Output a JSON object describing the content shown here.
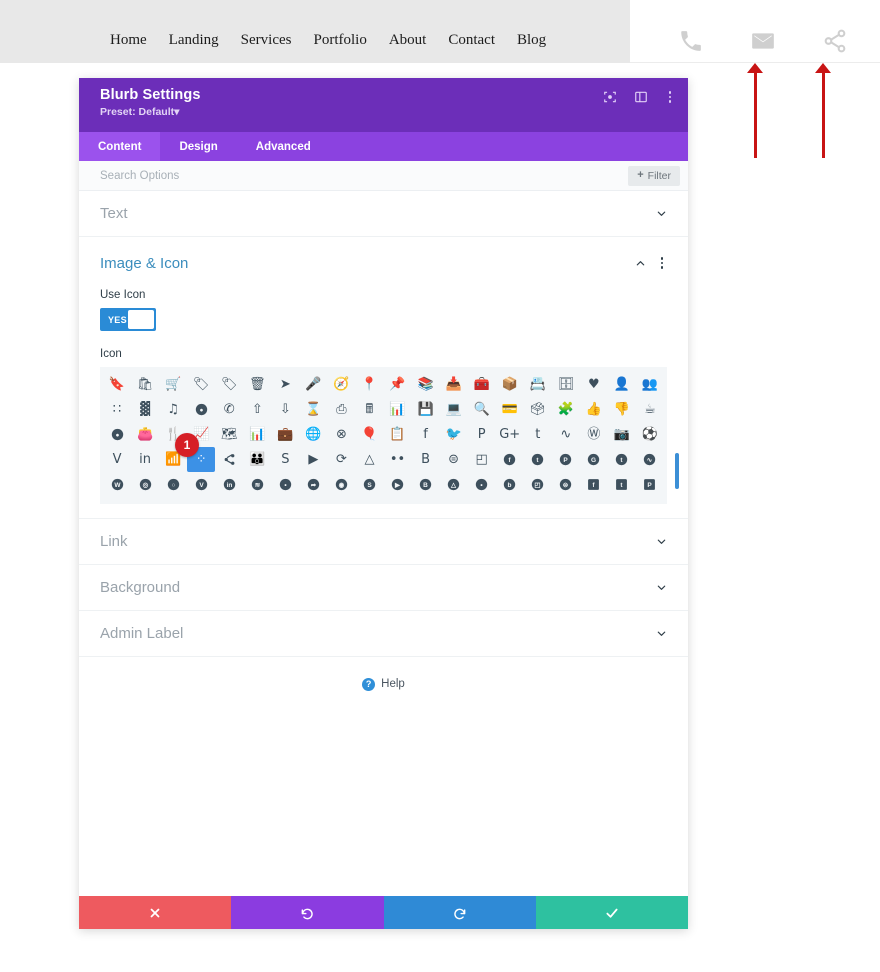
{
  "site_header": {
    "nav": [
      {
        "label": "Home"
      },
      {
        "label": "Landing"
      },
      {
        "label": "Services"
      },
      {
        "label": "Portfolio"
      },
      {
        "label": "About"
      },
      {
        "label": "Contact"
      },
      {
        "label": "Blog"
      }
    ],
    "icons": [
      {
        "name": "phone-icon"
      },
      {
        "name": "mail-icon"
      },
      {
        "name": "share-icon"
      }
    ],
    "background": "#e8e8e8"
  },
  "annotations": {
    "arrow_color": "#c81414",
    "arrows": [
      {
        "target": "mail-icon"
      },
      {
        "target": "share-icon"
      }
    ]
  },
  "modal": {
    "title": "Blurb Settings",
    "preset": "Preset: Default",
    "preset_caret": "▾",
    "header_color": "#6c2eb9",
    "header_icons": [
      {
        "name": "focus-target-icon"
      },
      {
        "name": "layout-panel-icon"
      },
      {
        "name": "kebab-menu-icon"
      }
    ],
    "tabs": [
      {
        "label": "Content",
        "active": true
      },
      {
        "label": "Design",
        "active": false
      },
      {
        "label": "Advanced",
        "active": false
      }
    ],
    "search": {
      "placeholder": "Search Options",
      "value": "",
      "filter_label": "Filter",
      "filter_plus": "+"
    },
    "sections": [
      {
        "label": "Text",
        "open": false
      },
      {
        "label": "Image & Icon",
        "open": true
      },
      {
        "label": "Link",
        "open": false
      },
      {
        "label": "Background",
        "open": false
      },
      {
        "label": "Admin Label",
        "open": false
      }
    ],
    "image_icon_section": {
      "use_icon_label": "Use Icon",
      "use_icon_value": "YES",
      "icon_field_label": "Icon",
      "selected_icon_index": 63,
      "selected_badge": "1",
      "selected_icon_name": "share-nodes-icon",
      "selected_color": "#3c91e6",
      "grid_columns": 20,
      "icons": [
        "bookmark-icon",
        "briefcase-bag-icon",
        "shopping-cart-icon",
        "tag-icon",
        "tag-filled-icon",
        "trash-icon",
        "cursor-arrow-icon",
        "microphone-icon",
        "compass-icon",
        "map-pin-icon",
        "pushpin-icon",
        "books-icon",
        "inbox-tray-icon",
        "toolbox-icon",
        "box-archive-icon",
        "id-card-icon",
        "archive-box-icon",
        "heart-icon",
        "user-icon",
        "users-icon",
        "grid-four-icon",
        "grid-nine-icon",
        "music-note-icon",
        "pause-circle-icon",
        "phone-icon",
        "upload-icon",
        "download-icon",
        "hourglass-icon",
        "printer-icon",
        "calculator-icon",
        "bar-chart-icon",
        "floppy-disk-icon",
        "laptop-icon",
        "document-search-icon",
        "card-icon",
        "toolbox-open-icon",
        "puzzle-piece-icon",
        "thumbs-up-icon",
        "thumbs-down-icon",
        "mug-icon",
        "dollar-circle-icon",
        "wallet-icon",
        "cutlery-icon",
        "presentation-chart-icon",
        "sitemap-icon",
        "chart-column-icon",
        "suitcase-icon",
        "globe-split-icon",
        "globe-cross-icon",
        "balloon-icon",
        "clipboard-icon",
        "facebook-f-icon",
        "twitter-bird-icon",
        "pinterest-p-icon",
        "google-plus-icon",
        "tumblr-t-icon",
        "soundwave-icon",
        "wordpress-icon",
        "instagram-icon",
        "dribbble-icon",
        "vimeo-v-icon",
        "linkedin-in-icon",
        "rss-icon",
        "flickr-icon",
        "share-nodes-icon",
        "meetup-icon",
        "skype-icon",
        "youtube-icon",
        "tripadvisor-icon",
        "google-drive-icon",
        "flickr-dots-icon",
        "blogger-b-icon",
        "spotify-icon",
        "delicious-icon",
        "facebook-circle-icon",
        "twitter-circle-icon",
        "pinterest-circle-icon",
        "google-circle-icon",
        "tumblr-circle-icon",
        "soundcloud-circle-icon",
        "wordpress-circle-icon",
        "instagram-circle-icon",
        "dribbble-circle-icon",
        "vimeo-circle-icon",
        "linkedin-circle-icon",
        "rss-circle-icon",
        "flickr-circle-icon",
        "share-circle-icon",
        "tripadvisor-circle-icon",
        "skype-circle-icon",
        "youtube-circle-icon",
        "behance-circle-icon",
        "drive-circle-icon",
        "flickr-dots-circle-icon",
        "blogger-circle-icon",
        "delicious-circle-icon",
        "spotify-circle-icon",
        "facebook-square-icon",
        "twitter-square-icon",
        "pinterest-square-icon"
      ]
    },
    "help": {
      "label": "Help",
      "icon": "question-mark-icon",
      "mark": "?"
    },
    "actions": [
      {
        "name": "cancel-button",
        "icon": "x-icon",
        "color": "#ee5a5f"
      },
      {
        "name": "undo-button",
        "icon": "undo-icon",
        "color": "#8b3ce0"
      },
      {
        "name": "redo-button",
        "icon": "redo-icon",
        "color": "#2f8ad6"
      },
      {
        "name": "save-button",
        "icon": "check-icon",
        "color": "#2ec1a0"
      }
    ]
  }
}
